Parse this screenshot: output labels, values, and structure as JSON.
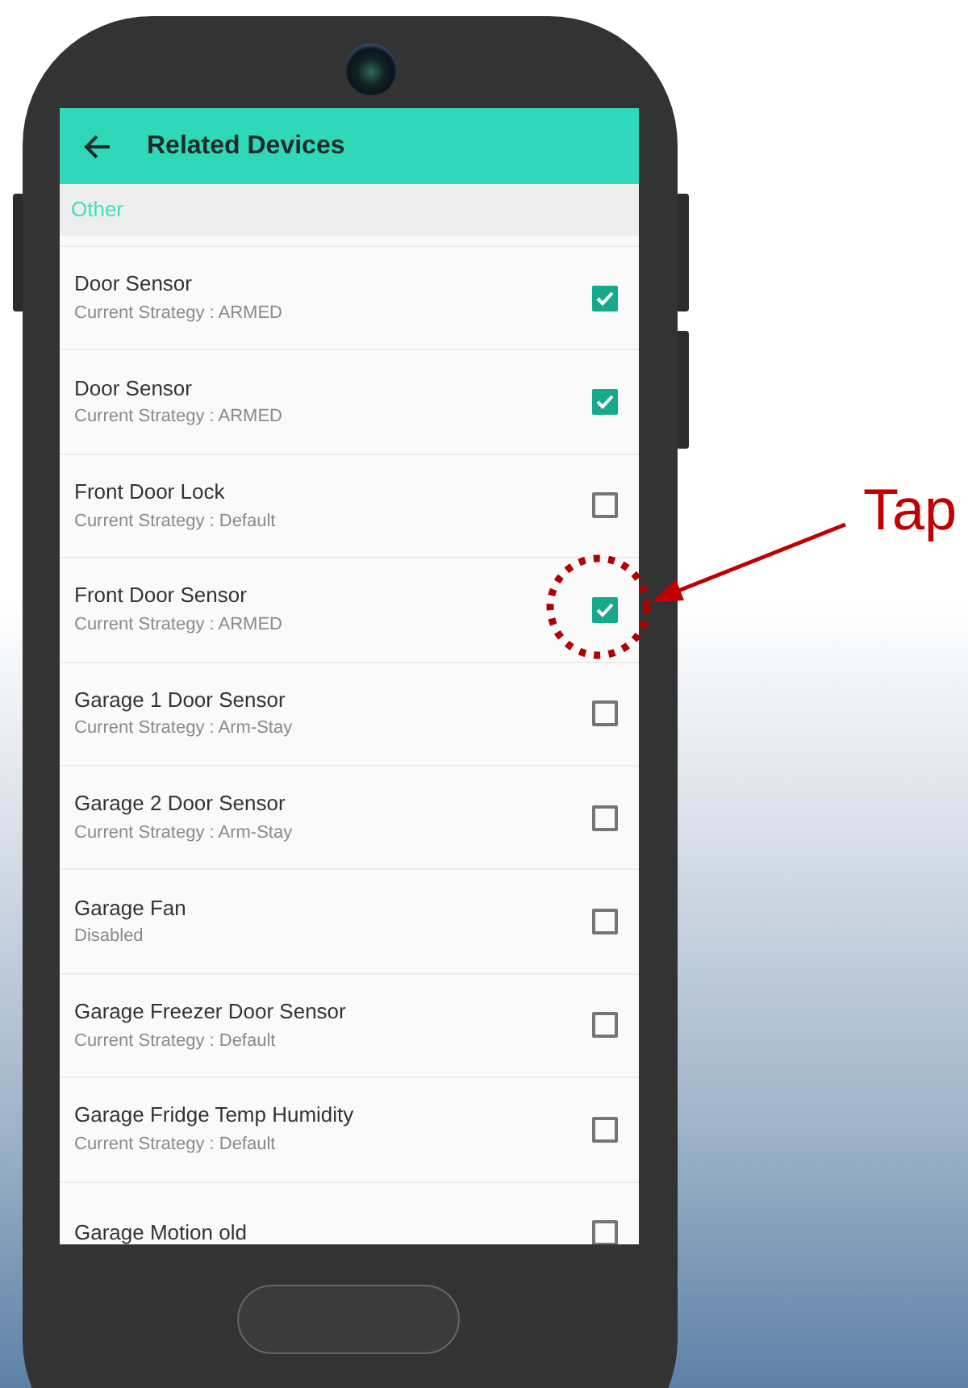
{
  "app_bar": {
    "title": "Related Devices"
  },
  "section": {
    "header": "Other"
  },
  "devices": [
    {
      "name": "Door Sensor",
      "status": "Current Strategy : ARMED",
      "checked": true
    },
    {
      "name": "Door Sensor",
      "status": "Current Strategy : ARMED",
      "checked": true
    },
    {
      "name": "Front Door Lock",
      "status": "Current Strategy : Default",
      "checked": false
    },
    {
      "name": "Front Door Sensor",
      "status": "Current Strategy : ARMED",
      "checked": true
    },
    {
      "name": "Garage 1 Door Sensor",
      "status": "Current Strategy : Arm-Stay",
      "checked": false
    },
    {
      "name": "Garage 2 Door Sensor",
      "status": "Current Strategy : Arm-Stay",
      "checked": false
    },
    {
      "name": "Garage Fan",
      "status": "Disabled",
      "checked": false
    },
    {
      "name": "Garage Freezer Door Sensor",
      "status": "Current Strategy : Default",
      "checked": false
    },
    {
      "name": "Garage Fridge Temp Humidity",
      "status": "Current Strategy : Default",
      "checked": false
    },
    {
      "name": "Garage Motion old",
      "checked": false
    }
  ],
  "annotation": {
    "label": "Tap"
  }
}
